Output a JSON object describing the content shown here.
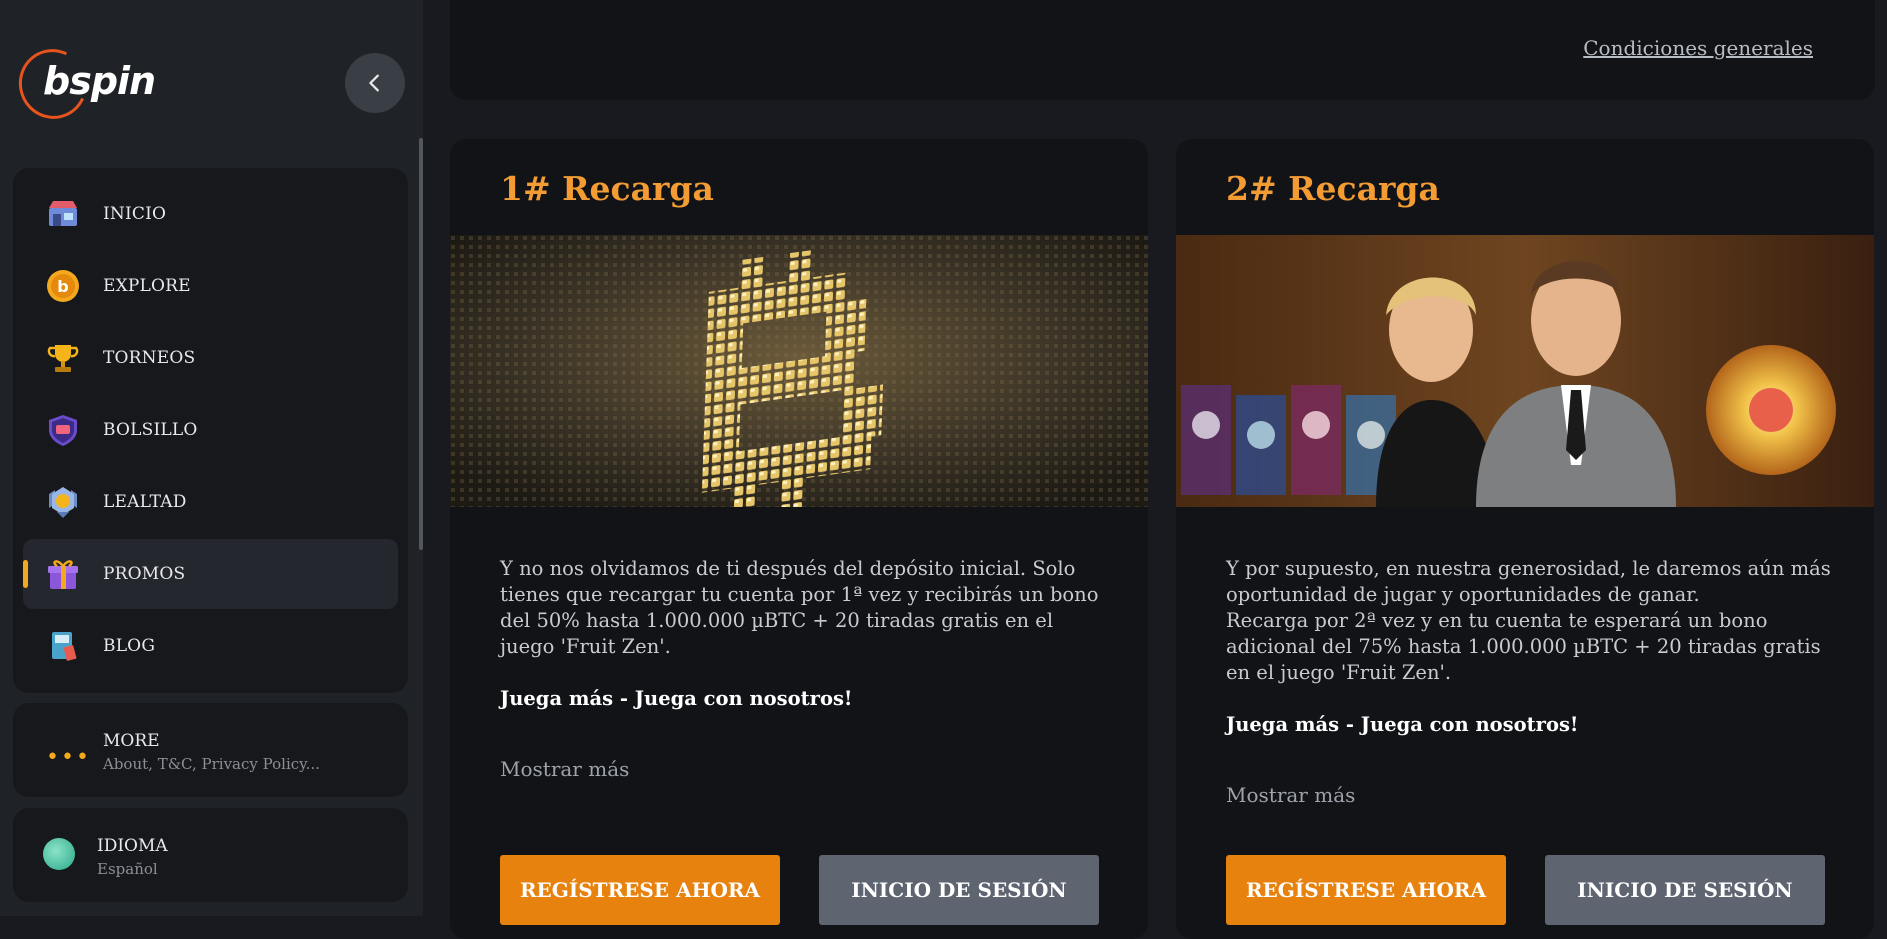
{
  "brand": {
    "name": "bspin"
  },
  "sidebar": {
    "items": [
      {
        "label": "INICIO",
        "icon": "shop-icon"
      },
      {
        "label": "EXPLORE",
        "icon": "bitcoin-coin-icon"
      },
      {
        "label": "TORNEOS",
        "icon": "trophy-icon"
      },
      {
        "label": "BOLSILLO",
        "icon": "wallet-shield-icon"
      },
      {
        "label": "LEALTAD",
        "icon": "loyalty-badge-icon"
      },
      {
        "label": "PROMOS",
        "icon": "gift-icon",
        "active": true
      },
      {
        "label": "BLOG",
        "icon": "book-icon"
      }
    ],
    "more": {
      "title": "MORE",
      "subtitle": "About, T&C, Privacy Policy..."
    },
    "language": {
      "title": "IDIOMA",
      "value": "Español"
    }
  },
  "header": {
    "conditions_link": "Condiciones generales"
  },
  "promos": [
    {
      "title": "1# Recarga",
      "paragraphs": [
        "Y no nos olvidamos de ti después del depósito inicial. Solo tienes que recargar tu cuenta por 1ª vez y recibirás un bono del 50% hasta 1.000.000 µBTC + 20 tiradas gratis en el juego 'Fruit Zen'."
      ],
      "tagline": "Juega más - Juega con nosotros!",
      "show_more": "Mostrar más",
      "register": "REGÍSTRESE AHORA",
      "login": "INICIO DE SESIÓN"
    },
    {
      "title": "2# Recarga",
      "paragraphs": [
        "Y por supuesto, en nuestra generosidad, le daremos aún más oportunidad de jugar y oportunidades de ganar.",
        "Recarga por 2ª vez y en tu cuenta te esperará un bono adicional del 75% hasta 1.000.000 µBTC + 20 tiradas gratis en el juego 'Fruit Zen'."
      ],
      "tagline": "Juega más - Juega con nosotros!",
      "show_more": "Mostrar más",
      "register": "REGÍSTRESE AHORA",
      "login": "INICIO DE SESIÓN"
    }
  ],
  "colors": {
    "accent": "#f39c34",
    "button_primary": "#e8820f",
    "button_secondary": "#5f6570",
    "logo_ring": "#e8541e"
  }
}
